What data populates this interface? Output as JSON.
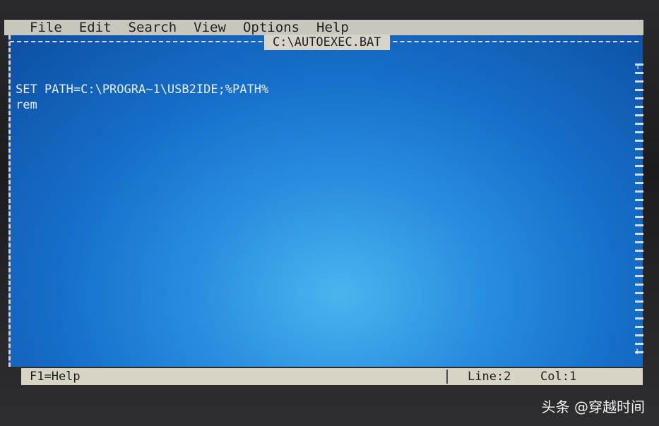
{
  "menu": [
    {
      "label": "File"
    },
    {
      "label": "Edit"
    },
    {
      "label": "Search"
    },
    {
      "label": "View"
    },
    {
      "label": "Options"
    },
    {
      "label": "Help"
    }
  ],
  "document": {
    "title": "C:\\AUTOEXEC.BAT",
    "lines": [
      "SET PATH=C:\\PROGRA~1\\USB2IDE;%PATH%",
      "rem"
    ]
  },
  "status": {
    "help": "F1=Help",
    "line": "Line:2",
    "col": "Col:1"
  },
  "watermark": "头条 @穿越时间",
  "icons": {
    "scroll_up": "up-arrow-icon",
    "scroll_down": "down-arrow-icon"
  }
}
